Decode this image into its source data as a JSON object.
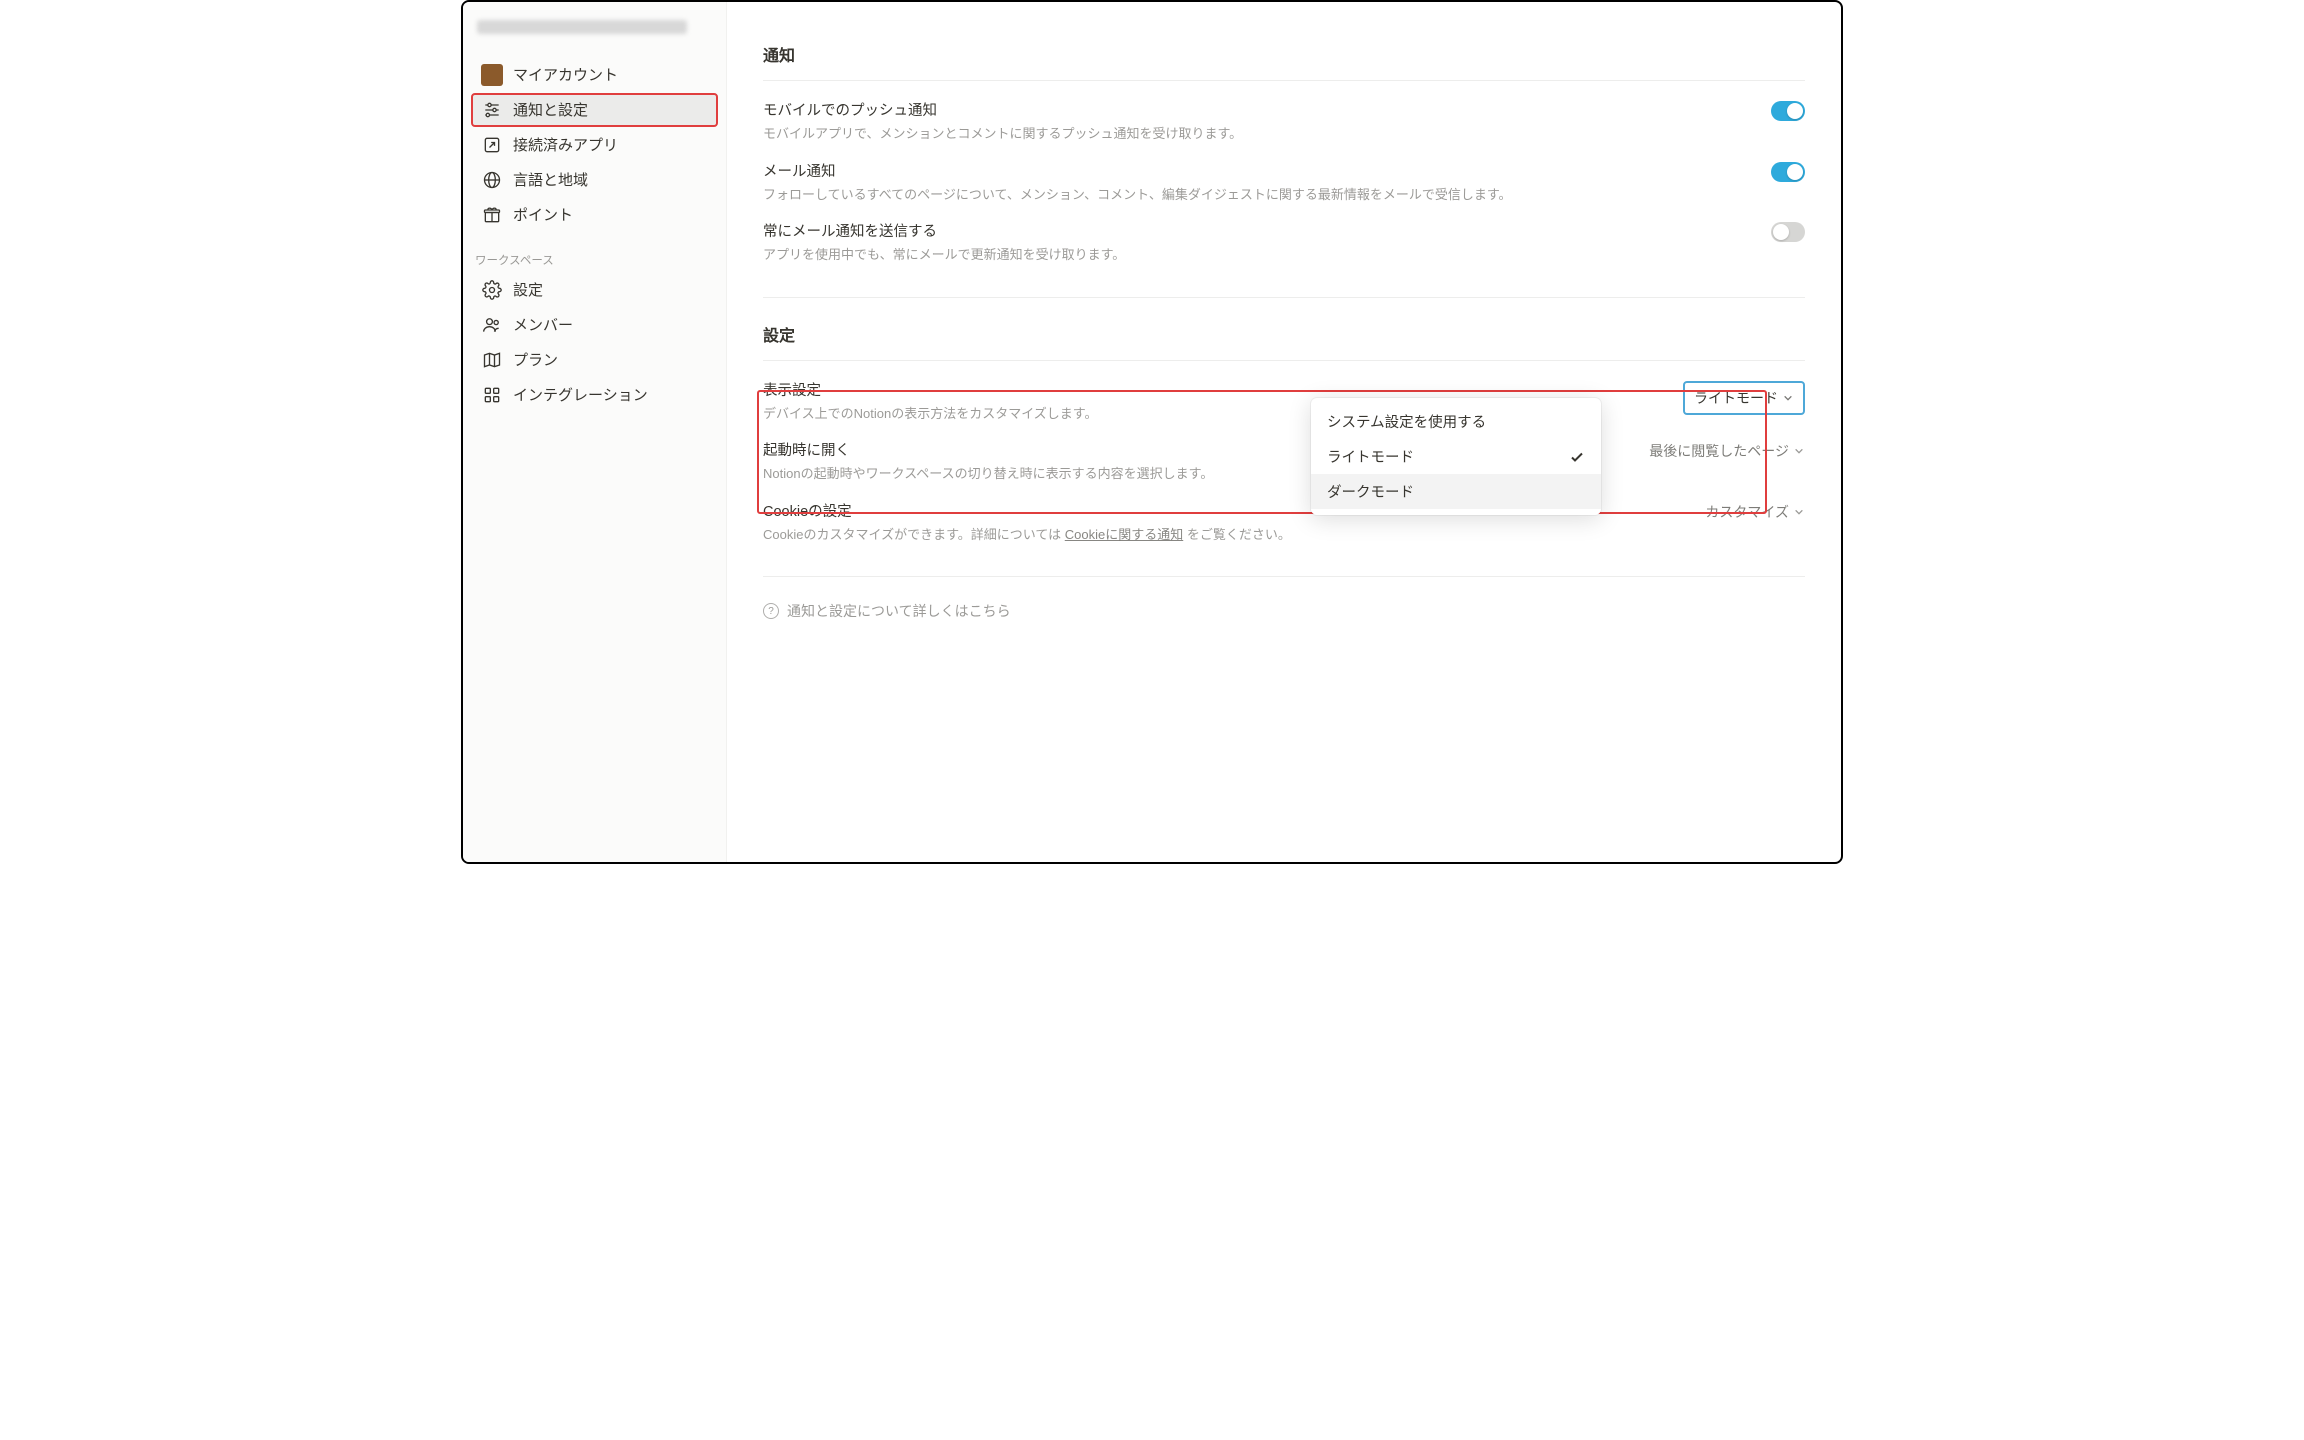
{
  "sidebar": {
    "items": [
      {
        "label": "マイアカウント",
        "icon": "avatar"
      },
      {
        "label": "通知と設定",
        "icon": "sliders",
        "active": true,
        "highlighted": true
      },
      {
        "label": "接続済みアプリ",
        "icon": "arrow-box"
      },
      {
        "label": "言語と地域",
        "icon": "globe"
      },
      {
        "label": "ポイント",
        "icon": "gift"
      }
    ],
    "workspace_label": "ワークスペース",
    "workspace_items": [
      {
        "label": "設定",
        "icon": "gear"
      },
      {
        "label": "メンバー",
        "icon": "people"
      },
      {
        "label": "プラン",
        "icon": "map"
      },
      {
        "label": "インテグレーション",
        "icon": "grid"
      }
    ]
  },
  "main": {
    "notifications": {
      "title": "通知",
      "rows": [
        {
          "label": "モバイルでのプッシュ通知",
          "desc": "モバイルアプリで、メンションとコメントに関するプッシュ通知を受け取ります。",
          "toggle": true
        },
        {
          "label": "メール通知",
          "desc": "フォローしているすべてのページについて、メンション、コメント、編集ダイジェストに関する最新情報をメールで受信します。",
          "toggle": true
        },
        {
          "label": "常にメール通知を送信する",
          "desc": "アプリを使用中でも、常にメールで更新通知を受け取ります。",
          "toggle": false
        }
      ]
    },
    "settings": {
      "title": "設定",
      "appearance": {
        "label": "表示設定",
        "desc": "デバイス上でのNotionの表示方法をカスタマイズします。",
        "selected": "ライトモード",
        "dropdown": {
          "items": [
            {
              "label": "システム設定を使用する",
              "checked": false
            },
            {
              "label": "ライトモード",
              "checked": true
            },
            {
              "label": "ダークモード",
              "checked": false,
              "hovered": true
            }
          ]
        }
      },
      "startup": {
        "label": "起動時に開く",
        "desc": "Notionの起動時やワークスペースの切り替え時に表示する内容を選択します。",
        "selected": "最後に閲覧したページ"
      },
      "cookies": {
        "label": "Cookieの設定",
        "desc_prefix": "Cookieのカスタマイズができます。詳細については ",
        "desc_link": "Cookieに関する通知",
        "desc_suffix": " をご覧ください。",
        "selected": "カスタマイズ"
      }
    },
    "help_text": "通知と設定について詳しくはこちら"
  }
}
